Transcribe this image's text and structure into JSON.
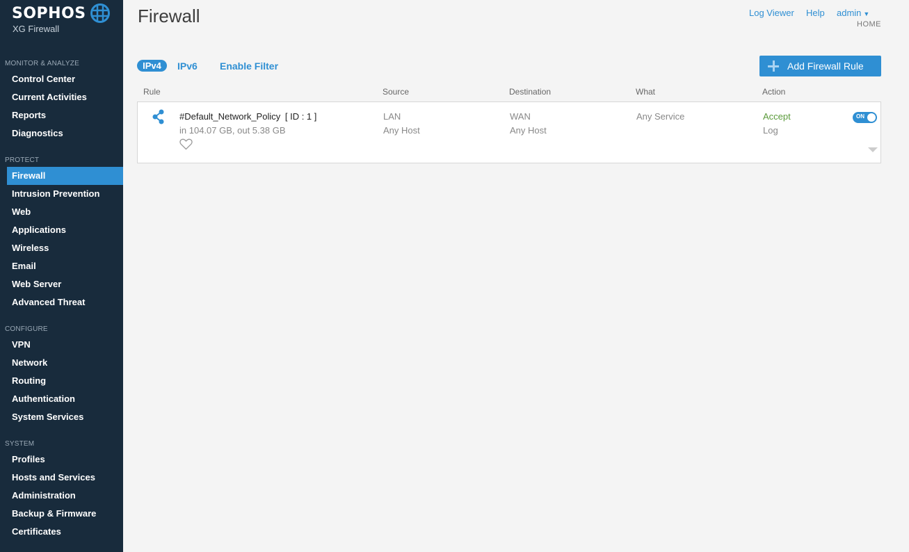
{
  "brand": {
    "name": "SOPHOS",
    "product": "XG Firewall"
  },
  "sidebar": {
    "sections": [
      {
        "label": "MONITOR & ANALYZE",
        "items": [
          "Control Center",
          "Current Activities",
          "Reports",
          "Diagnostics"
        ]
      },
      {
        "label": "PROTECT",
        "items": [
          "Firewall",
          "Intrusion Prevention",
          "Web",
          "Applications",
          "Wireless",
          "Email",
          "Web Server",
          "Advanced Threat"
        ]
      },
      {
        "label": "CONFIGURE",
        "items": [
          "VPN",
          "Network",
          "Routing",
          "Authentication",
          "System Services"
        ]
      },
      {
        "label": "SYSTEM",
        "items": [
          "Profiles",
          "Hosts and Services",
          "Administration",
          "Backup & Firmware",
          "Certificates"
        ]
      }
    ],
    "active_item": "Firewall"
  },
  "header": {
    "title": "Firewall",
    "links": {
      "log_viewer": "Log Viewer",
      "help": "Help",
      "admin": "admin"
    },
    "breadcrumb": "HOME"
  },
  "filters": {
    "ipv4": "IPv4",
    "ipv6": "IPv6",
    "enable_filter": "Enable Filter"
  },
  "add_button": "Add Firewall Rule",
  "table": {
    "columns": {
      "rule": "Rule",
      "source": "Source",
      "destination": "Destination",
      "what": "What",
      "action": "Action"
    },
    "rows": [
      {
        "name": "#Default_Network_Policy",
        "id_label": "[ ID : 1 ]",
        "traffic": "in 104.07 GB, out 5.38 GB",
        "source_zone": "LAN",
        "source_host": "Any Host",
        "dest_zone": "WAN",
        "dest_host": "Any Host",
        "what": "Any Service",
        "action": "Accept",
        "log": "Log",
        "toggle": "ON"
      }
    ]
  },
  "colors": {
    "sidebar_bg": "#182b3c",
    "accent": "#2f8fd3",
    "accept": "#5a9a3a"
  },
  "icons": {
    "share": "share-icon",
    "heart": "heart-icon",
    "plus": "plus-icon",
    "globe": "globe-icon"
  }
}
